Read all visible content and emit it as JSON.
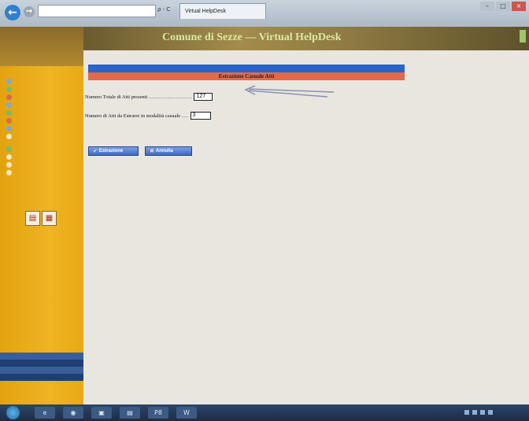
{
  "browser": {
    "back_glyph": "←",
    "forward_glyph": "→",
    "address": "",
    "address_controls": "ρ - C",
    "tab_title": "Virtual HelpDesk",
    "window_controls": [
      "–",
      "□",
      "×"
    ]
  },
  "header": {
    "title": "Comune di Sezze — Virtual HelpDesk"
  },
  "sidebar": {
    "top_lines": [],
    "menu_groups": [],
    "sub_label": "",
    "icons": [
      "document-icon",
      "grid-icon"
    ],
    "bottom_lines": []
  },
  "main": {
    "blue_bar_text": "",
    "section_title": "Estrazione Casuale Atti",
    "total_label": "Numero Totale di Atti presenti",
    "total_dots": "..........................",
    "total_value": "127",
    "extract_label": "Numero di Atti da Estrarre in modalità casuale",
    "extract_dots": "....",
    "extract_value": "3",
    "extract_button": "Estrazione",
    "cancel_button": "Annulla"
  },
  "taskbar": {
    "items": [
      "e",
      "◉",
      "▣",
      "▤",
      "P8",
      "W"
    ],
    "clock_time": "",
    "clock_date": ""
  },
  "colors": {
    "sidebar_orange": "#eeb423",
    "header_blue_bar": "#2a63c9",
    "section_red": "#df6a4c",
    "button_blue": "#3f6bc0"
  }
}
